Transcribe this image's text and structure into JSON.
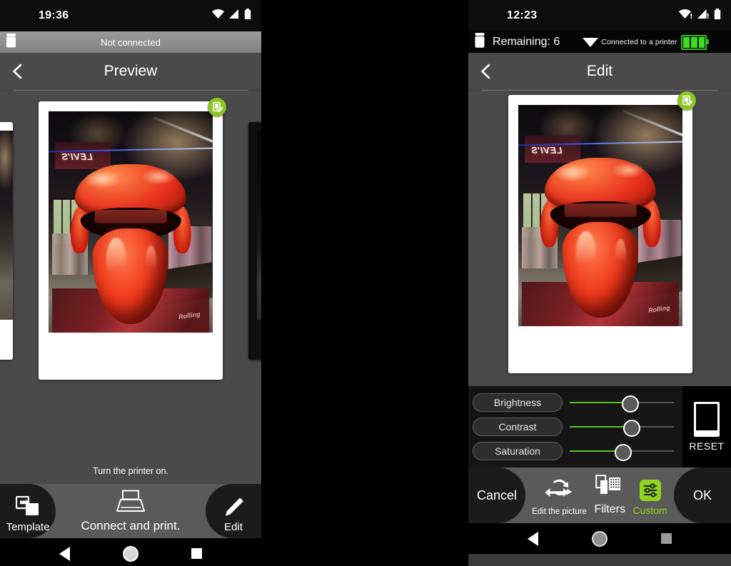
{
  "left_panel": {
    "status_bar": {
      "clock": "19:36",
      "icons": [
        "wifi-icon",
        "signal-icon",
        "battery-icon"
      ]
    },
    "printer_bar": {
      "ink_icon": "ink-cartridge-icon",
      "status_text": "Not connected"
    },
    "title_bar": {
      "back_icon": "back-chevron-icon",
      "title": "Preview"
    },
    "photo": {
      "badge_icon": "printable-check-badge-icon",
      "scene_sign": "LEVI'S"
    },
    "hint": "Turn the printer on.",
    "toolbar": {
      "template_label": "Template",
      "template_icon": "template-swap-icon",
      "connect_label": "Connect and print.",
      "connect_icon": "printer-icon",
      "edit_label": "Edit",
      "edit_icon": "pencil-icon"
    },
    "nav_bar": {
      "back": "nav-back-icon",
      "home": "nav-home-icon",
      "recents": "nav-recents-icon"
    }
  },
  "right_panel": {
    "status_bar": {
      "clock": "12:23",
      "icons": [
        "wifi-alert-icon",
        "signal-alert-icon",
        "battery-icon"
      ]
    },
    "printer_bar": {
      "ink_icon": "ink-cartridge-icon",
      "remaining_text": "Remaining: 6",
      "dropdown_icon": "triangle-down-icon",
      "status_text": "Connected to a printer",
      "battery_icon": "printer-battery-icon",
      "battery_cells": 3
    },
    "title_bar": {
      "back_icon": "back-chevron-icon",
      "title": "Edit"
    },
    "photo": {
      "badge_icon": "printable-check-badge-icon",
      "scene_sign": "LEVI'S"
    },
    "sliders": [
      {
        "label": "Brightness",
        "value": 57
      },
      {
        "label": "Contrast",
        "value": 58
      },
      {
        "label": "Saturation",
        "value": 50
      }
    ],
    "reset": {
      "label": "RESET",
      "icon": "polaroid-frame-icon"
    },
    "toolbar": {
      "cancel_label": "Cancel",
      "ok_label": "OK",
      "buttons": [
        {
          "label": "Edit the picture",
          "icon": "flip-rotate-icon",
          "active": false
        },
        {
          "label": "Filters",
          "icon": "filters-icon",
          "active": false
        },
        {
          "label": "Custom",
          "icon": "sliders-icon",
          "active": true
        }
      ]
    },
    "nav_bar": {
      "back": "nav-back-icon",
      "home": "nav-home-icon",
      "recents": "nav-recents-icon"
    }
  },
  "colors": {
    "accent_green": "#8fd41d",
    "slider_green": "#56c614",
    "panel_gray": "#4a4a4a",
    "toolbar_gray": "#5a5a5a",
    "pill_black": "#1b1b1b"
  }
}
